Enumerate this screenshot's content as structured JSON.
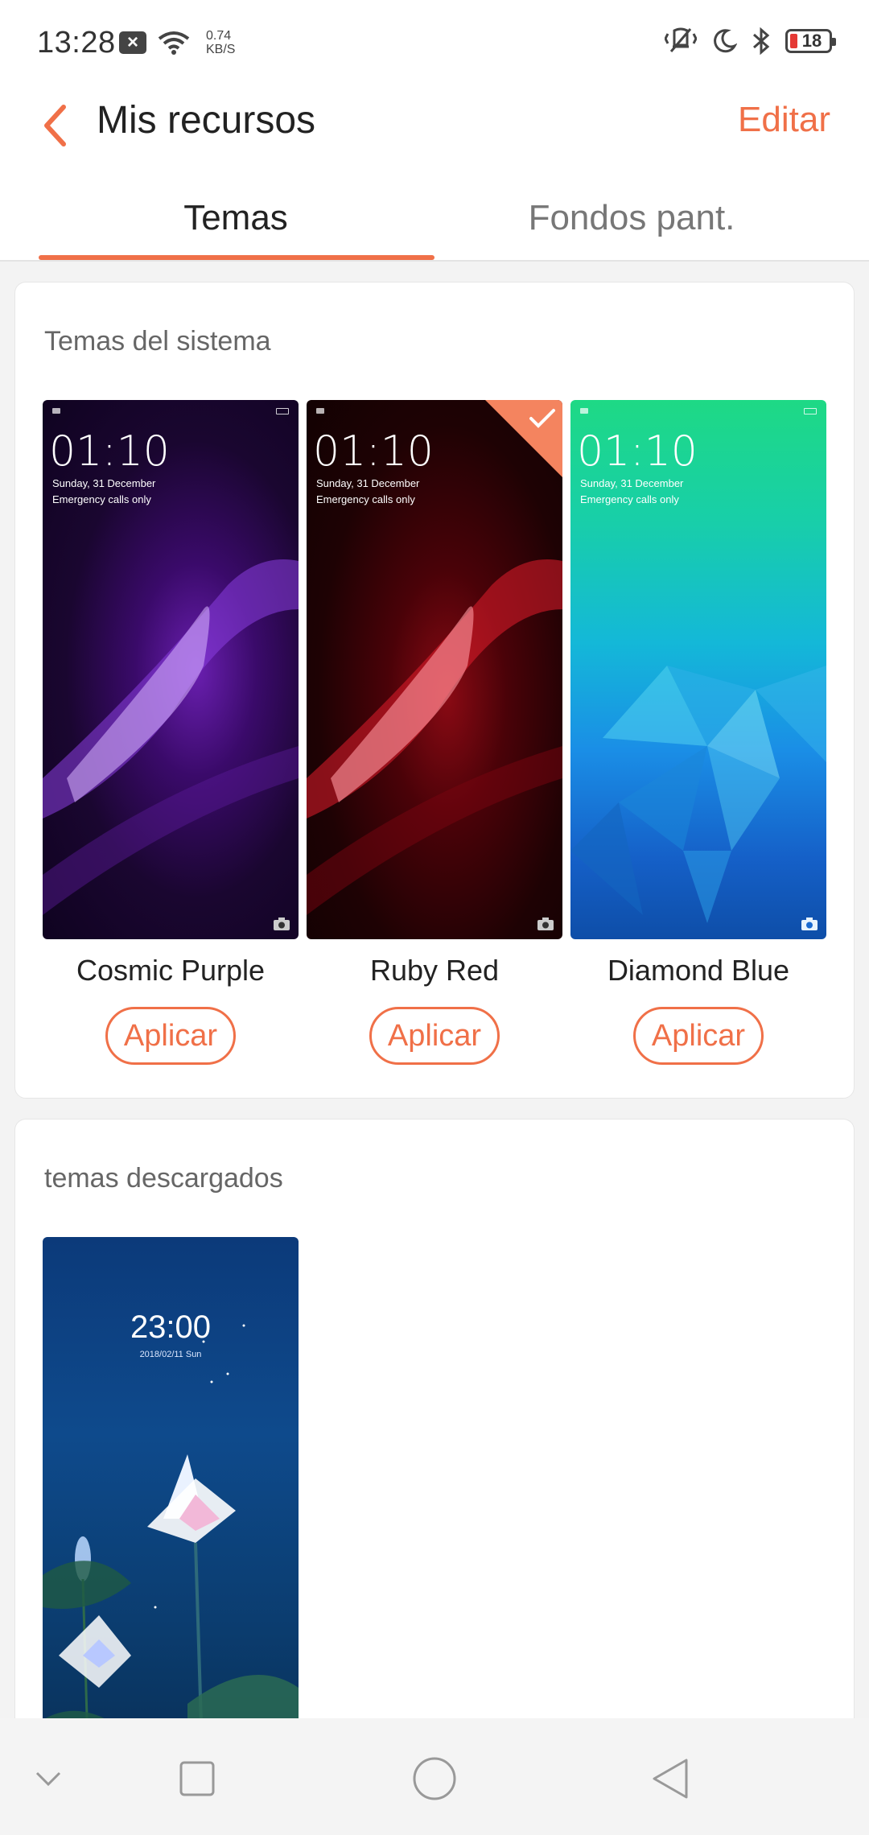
{
  "status_bar": {
    "time": "13:28",
    "speed_value": "0.74",
    "speed_unit": "KB/S",
    "battery": "18"
  },
  "header": {
    "title": "Mis recursos",
    "edit_label": "Editar"
  },
  "tabs": [
    {
      "label": "Temas",
      "active": true
    },
    {
      "label": "Fondos pant.",
      "active": false
    }
  ],
  "system_themes": {
    "heading": "Temas del sistema",
    "items": [
      {
        "name": "Cosmic Purple",
        "apply_label": "Aplicar",
        "clock": "01:10",
        "date": "Sunday, 31 December",
        "status": "Emergency calls only",
        "selected": false
      },
      {
        "name": "Ruby Red",
        "apply_label": "Aplicar",
        "clock": "01:10",
        "date": "Sunday, 31 December",
        "status": "Emergency calls only",
        "selected": true
      },
      {
        "name": "Diamond Blue",
        "apply_label": "Aplicar",
        "clock": "01:10",
        "date": "Sunday, 31 December",
        "status": "Emergency calls only",
        "selected": false
      }
    ]
  },
  "downloaded_themes": {
    "heading": "temas descargados",
    "items": [
      {
        "clock": "23:00",
        "date": "2018/02/11 Sun"
      }
    ]
  },
  "colors": {
    "accent": "#f07048"
  },
  "icons": {
    "back": "chevron-left-icon",
    "nav": [
      "chevron-down-icon",
      "square-icon",
      "circle-icon",
      "triangle-back-icon"
    ]
  }
}
